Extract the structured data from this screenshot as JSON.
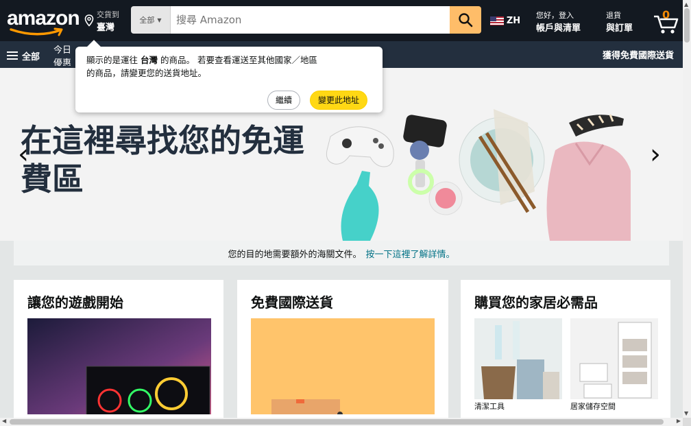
{
  "nav": {
    "logo_text": "amazon",
    "deliver_line1": "交貨到",
    "deliver_line2": "臺灣",
    "search_category": "全部",
    "search_placeholder": "搜尋 Amazon",
    "language": "ZH",
    "account_line1": "您好，登入",
    "account_line2": "帳戶與清單",
    "orders_line1": "退貨",
    "orders_line2": "與訂單",
    "cart_count": "0"
  },
  "subnav": {
    "all_label": "全部",
    "today_label": "今日優惠",
    "free_shipping_label": "獲得免費國際送貨"
  },
  "popover": {
    "text_prefix": "顯示的是運往",
    "country": "台灣",
    "text_mid": "的商品。 若要查看運送至其他國家／地區",
    "text_line2": "的商品，請變更您的送貨地址。",
    "continue_label": "繼續",
    "change_label": "變更此地址"
  },
  "hero": {
    "title": "在這裡尋找您的免運費區",
    "prev": "‹",
    "next": "›"
  },
  "customs": {
    "text": "您的目的地需要額外的海關文件。",
    "link": "按一下這裡了解詳情。"
  },
  "cards": [
    {
      "title": "讓您的遊戲開始"
    },
    {
      "title": "免費國際送貨"
    },
    {
      "title": "購買您的家居必需品",
      "items": [
        {
          "caption": "清潔工具"
        },
        {
          "caption": "居家儲存空間"
        }
      ]
    }
  ],
  "colors": {
    "nav_bg": "#131921",
    "subnav_bg": "#232f3e",
    "search_btn": "#febd69",
    "cart_count": "#f08804",
    "change_btn": "#ffd814",
    "link": "#007185"
  }
}
